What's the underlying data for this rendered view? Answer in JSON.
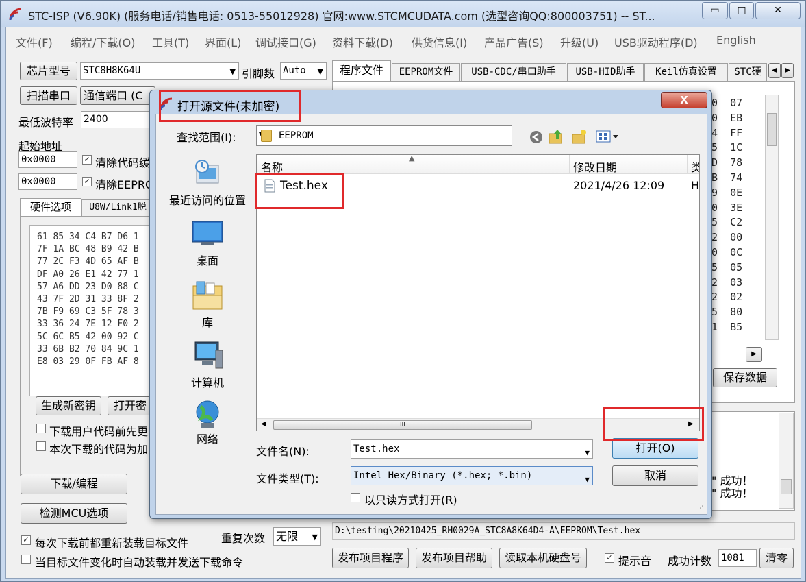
{
  "window": {
    "title": "STC-ISP (V6.90K) (服务电话/销售电话: 0513-55012928) 官网:www.STCMCUDATA.com  (选型咨询QQ:800003751) -- ST...",
    "min": "▭",
    "max": "□",
    "close": "✕"
  },
  "menu": [
    "文件(F)",
    "编程/下载(O)",
    "工具(T)",
    "界面(L)",
    "调试接口(G)",
    "资料下载(D)",
    "供货信息(I)",
    "产品广告(S)",
    "升级(U)",
    "USB驱动程序(D)",
    "English"
  ],
  "left": {
    "chip_label": "芯片型号",
    "chip_value": "STC8H8K64U",
    "pin_label": "引脚数",
    "pin_value": "Auto",
    "scan_label": "扫描串口",
    "port_label": "通信端口 (C",
    "baud_label": "最低波特率",
    "baud_value": "2400",
    "start_addr_label": "起始地址",
    "addr1": "0x0000",
    "clear_code": "清除代码缓",
    "addr2": "0x0000",
    "clear_eeprom": "清除EEPRO",
    "tab1": "硬件选项",
    "tab2": "U8W/Link1脱",
    "hex": [
      "61 85 34 C4 B7 D6 1",
      "7F 1A BC 48 B9 42 B",
      "77 2C F3 4D 65 AF B",
      "DF A0 26 E1 42 77 1",
      "57 A6 DD 23 D0 88 C",
      "43 7F 2D 31 33 8F 2",
      "7B F9 69 C3 5F 78 3",
      "33 36 24 7E 12 F0 2",
      "5C 6C B5 42 00 92 C",
      "33 6B B2 70 84 9C 1",
      "E8 03 29 0F FB AF 8"
    ],
    "gen_key": "生成新密钥",
    "open_key": "打开密",
    "opt1": "下载用户代码前先更",
    "opt2": "本次下载的代码为加",
    "download": "下载/编程",
    "detect": "检测MCU选项",
    "reload": "每次下载前都重新装载目标文件",
    "auto": "当目标文件变化时自动装载并发送下载命令",
    "repeat_label": "重复次数",
    "repeat_value": "无限"
  },
  "right": {
    "tabs": [
      "程序文件",
      "EEPROM文件",
      "USB-CDC/串口助手",
      "USB-HID助手",
      "Keil仿真设置",
      "STC硬"
    ],
    "hex_right": [
      "0  07",
      "0  EB",
      "4  FF",
      "5  1C",
      "D  78",
      "B  74",
      "9  0E",
      "0  3E",
      "5  C2",
      "2  00",
      "0  0C",
      "5  05",
      "2  03",
      "2  02",
      "5  80",
      "1  B5"
    ],
    "save_data": "保存数据",
    "log1": "\" 成功！",
    "log2": "\" 成功！",
    "path": "D:\\testing\\20210425_RH0029A_STC8A8K64D4-A\\EEPROM\\Test.hex",
    "publish": "发布项目程序",
    "publish_help": "发布项目帮助",
    "read_disk": "读取本机硬盘号",
    "beep": "提示音",
    "count_label": "成功计数",
    "count_value": "1081",
    "clear": "清零"
  },
  "dialog": {
    "title": "打开源文件(未加密)",
    "close": "X",
    "lookin_label": "查找范围(I):",
    "lookin_value": "EEPROM",
    "places": [
      "最近访问的位置",
      "桌面",
      "库",
      "计算机",
      "网络"
    ],
    "columns": [
      "名称",
      "修改日期",
      "类"
    ],
    "file": {
      "name": "Test.hex",
      "date": "2021/4/26 12:09",
      "type": "H"
    },
    "scroll_mid": "III",
    "filename_label": "文件名(N):",
    "filename_value": "Test.hex",
    "filetype_label": "文件类型(T):",
    "filetype_value": "Intel Hex/Binary (*.hex; *.bin)",
    "readonly": "以只读方式打开(R)",
    "open": "打开(O)",
    "cancel": "取消"
  },
  "colors": {
    "highlight": "#e0292b",
    "title_bg": "#c3d5ec"
  }
}
